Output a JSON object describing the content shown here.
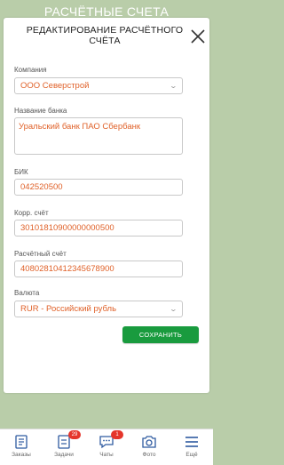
{
  "background": {
    "title": "РАСЧЁТНЫЕ СЧЕТА"
  },
  "modal": {
    "title": "РЕДАКТИРОВАНИЕ РАСЧЁТНОГО СЧЁТА",
    "fields": {
      "company": {
        "label": "Компания",
        "value": "ООО Северстрой"
      },
      "bank": {
        "label": "Название банка",
        "value": "Уральский банк ПАО Сбербанк"
      },
      "bik": {
        "label": "БИК",
        "value": "042520500"
      },
      "corr": {
        "label": "Корр. счёт",
        "value": "30101810900000000500"
      },
      "account": {
        "label": "Расчётный счёт",
        "value": "40802810412345678900"
      },
      "currency": {
        "label": "Валюта",
        "value": "RUR - Российский рубль"
      }
    },
    "save_label": "СОХРАНИТЬ"
  },
  "nav": {
    "items": [
      {
        "label": "Заказы",
        "icon": "orders-icon"
      },
      {
        "label": "Задачи",
        "icon": "tasks-icon",
        "badge": "29"
      },
      {
        "label": "Чаты",
        "icon": "chat-icon",
        "badge": "1"
      },
      {
        "label": "Фото",
        "icon": "camera-icon"
      },
      {
        "label": "Ещё",
        "icon": "menu-icon"
      }
    ]
  },
  "colors": {
    "accent": "#199b3e",
    "value_text": "#e0622a",
    "badge": "#e5352b",
    "backdrop": "#b9cda9"
  }
}
